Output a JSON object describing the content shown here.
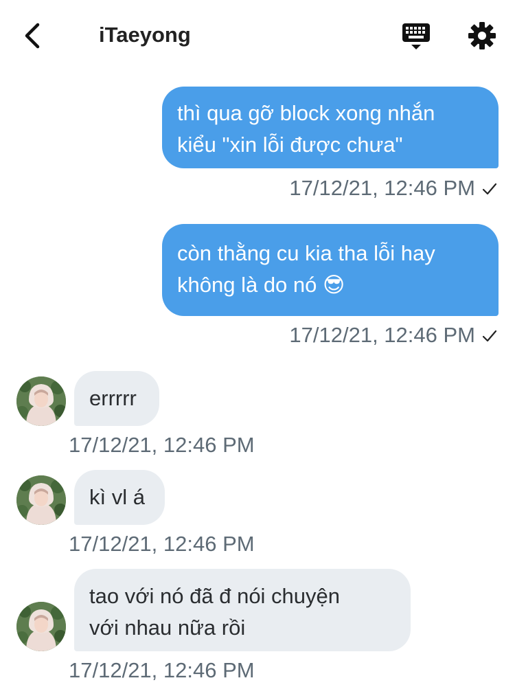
{
  "header": {
    "title": "iTaeyong",
    "back_icon": "chevron-left-icon",
    "keyboard_icon": "keyboard-icon",
    "settings_icon": "gear-icon"
  },
  "messages": [
    {
      "direction": "out",
      "text": "thì qua gỡ block xong nhắn\nkiểu \"xin lỗi được chưa\"",
      "timestamp": "17/12/21, 12:46 PM",
      "status_icon": "check-icon"
    },
    {
      "direction": "out",
      "text": "còn thằng cu kia tha lỗi hay\nkhông là do nó 😎",
      "timestamp": "17/12/21, 12:46 PM",
      "status_icon": "check-icon"
    },
    {
      "direction": "in",
      "text": "errrrr",
      "timestamp": "17/12/21, 12:46 PM"
    },
    {
      "direction": "in",
      "text": "kì vl á",
      "timestamp": "17/12/21, 12:46 PM"
    },
    {
      "direction": "in",
      "text": "tao với nó đã đ nói chuyện\nvới nhau nữa rồi",
      "timestamp": "17/12/21, 12:46 PM"
    }
  ],
  "colors": {
    "outgoing_bubble": "#4a9ee9",
    "incoming_bubble": "#e9edf1",
    "timestamp_text": "#5d6a75"
  }
}
